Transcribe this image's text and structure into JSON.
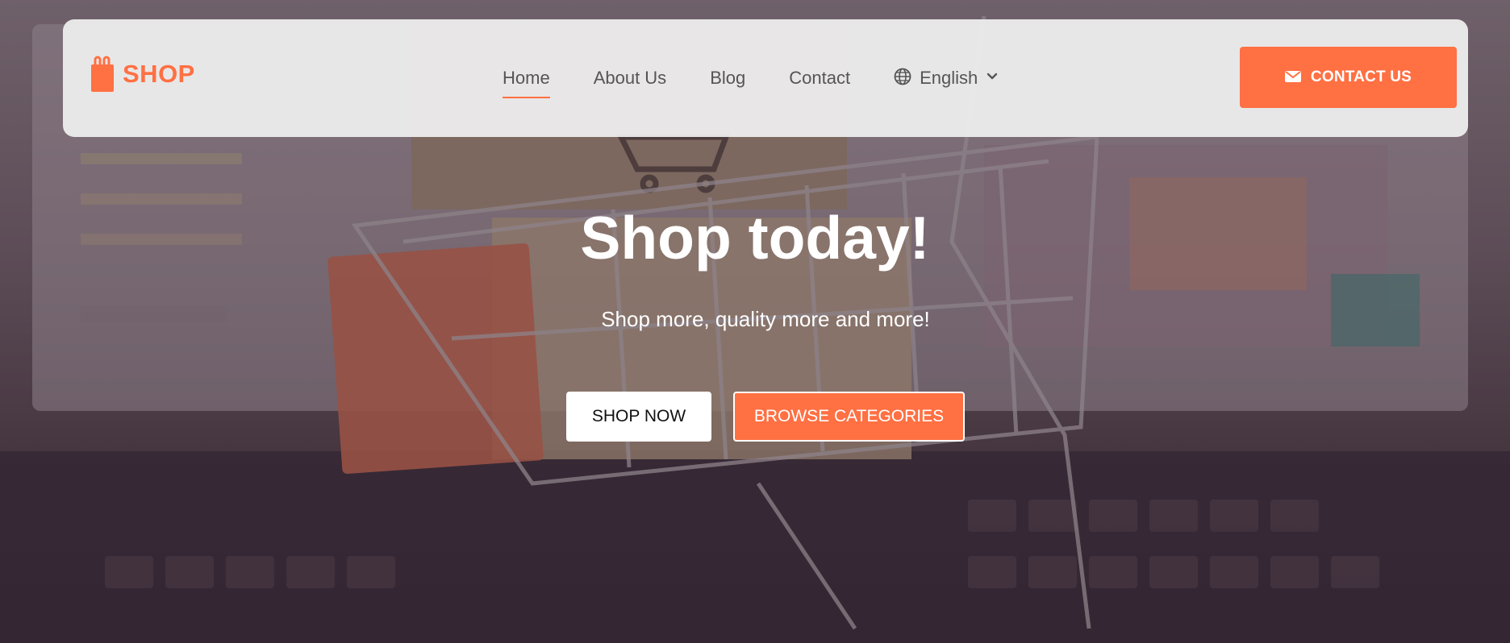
{
  "brand": {
    "logo_text": "SHOP",
    "logo_icon": "shopping-bag-icon",
    "accent_color": "#ff7043"
  },
  "nav": {
    "items": [
      {
        "label": "Home",
        "active": true
      },
      {
        "label": "About Us",
        "active": false
      },
      {
        "label": "Blog",
        "active": false
      },
      {
        "label": "Contact",
        "active": false
      }
    ],
    "language": {
      "label": "English",
      "icon": "globe-icon",
      "dropdown_icon": "chevron-down-icon"
    }
  },
  "header_cta": {
    "label": "CONTACT US",
    "icon": "envelope-icon"
  },
  "hero": {
    "title": "Shop today!",
    "subtitle": "Shop more, quality more and more!",
    "primary_button": "SHOP NOW",
    "secondary_button": "BROWSE CATEGORIES"
  }
}
